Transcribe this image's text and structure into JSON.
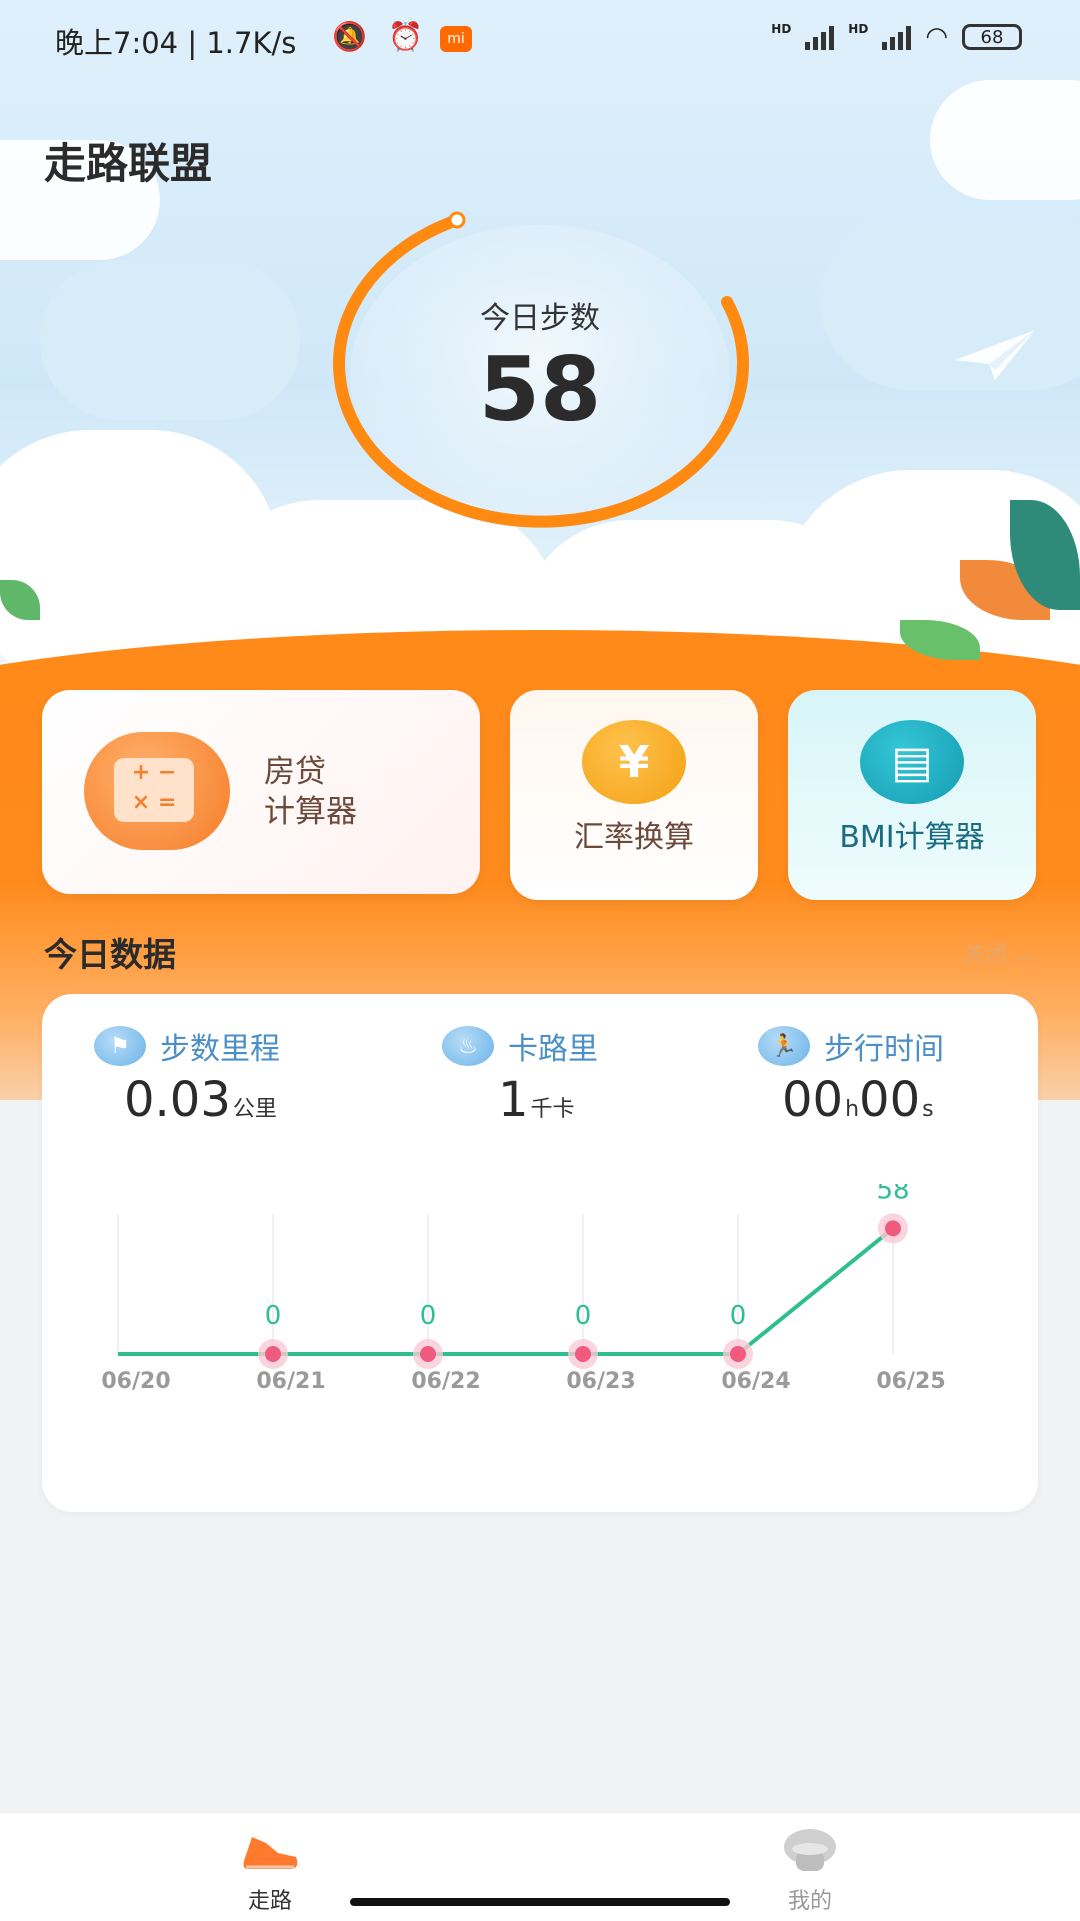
{
  "status_bar": {
    "time_speed": "晚上7:04 | 1.7K/s",
    "icons": [
      "mute-icon",
      "alarm-icon",
      "mi-icon"
    ],
    "signal_labels": [
      "HD",
      "HD"
    ],
    "battery": "68"
  },
  "app": {
    "title": "走路联盟"
  },
  "steps": {
    "label": "今日步数",
    "value": "58"
  },
  "tools": [
    {
      "label_line1": "房贷",
      "label_line2": "计算器",
      "icon": "calculator-icon",
      "glyph": "+ −\n× ="
    },
    {
      "label": "汇率换算",
      "icon": "yuan-icon",
      "glyph": "¥"
    },
    {
      "label": "BMI计算器",
      "icon": "clipboard-icon",
      "glyph": "▤"
    }
  ],
  "today": {
    "title": "今日数据",
    "toggle": "关闭",
    "stats": [
      {
        "label": "步数里程",
        "value": "0.03",
        "unit": "公里",
        "icon": "flag-icon"
      },
      {
        "label": "卡路里",
        "value": "1",
        "unit": "千卡",
        "icon": "flame-icon"
      },
      {
        "label": "步行时间",
        "value_h": "00",
        "unit_h": "h",
        "value_s": "00",
        "unit_s": "s",
        "icon": "runner-icon"
      }
    ]
  },
  "chart_data": {
    "type": "line",
    "categories": [
      "06/20",
      "06/21",
      "06/22",
      "06/23",
      "06/24",
      "06/25"
    ],
    "values": [
      0,
      0,
      0,
      0,
      0,
      58
    ],
    "data_labels": [
      "",
      "0",
      "0",
      "0",
      "0",
      "58"
    ],
    "line_color": "#2fbf8c",
    "point_color": "#f05a7e",
    "ylim": [
      0,
      60
    ]
  },
  "bottom_nav": [
    {
      "label": "走路",
      "icon": "shoe-icon",
      "active": true
    },
    {
      "label": "我的",
      "icon": "profile-icon",
      "active": false
    }
  ],
  "colors": {
    "accent": "#ff8b1c",
    "chart_line": "#2fbf8c",
    "stat_label": "#4a8fc8"
  }
}
